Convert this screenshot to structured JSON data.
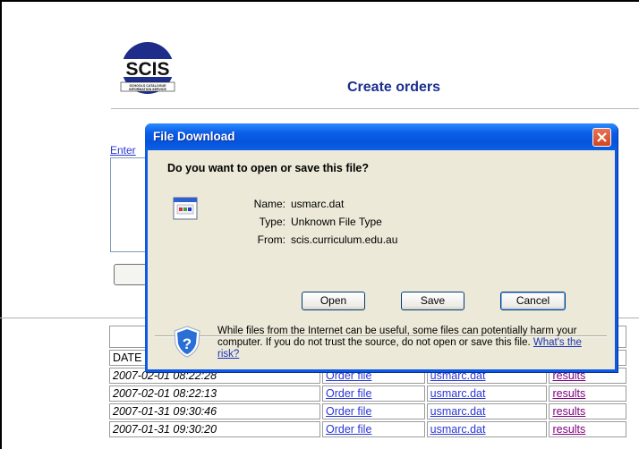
{
  "page": {
    "title": "Create orders",
    "logo_text": "SCIS",
    "logo_subtitle_1": "SCHOOLS CATALOGUE",
    "logo_subtitle_2": "INFORMATION SERVICE",
    "enter_link": "Enter"
  },
  "dialog": {
    "title": "File Download",
    "question": "Do you want to open or save this file?",
    "name_label": "Name:",
    "name_value": "usmarc.dat",
    "type_label": "Type:",
    "type_value": "Unknown File Type",
    "from_label": "From:",
    "from_value": "scis.curriculum.edu.au",
    "open_label": "Open",
    "save_label": "Save",
    "cancel_label": "Cancel",
    "warning_text": "While files from the Internet can be useful, some files can potentially harm your computer. If you do not trust the source, do not open or save this file.",
    "risk_link": "What's the risk?"
  },
  "table": {
    "date_header": "DATE",
    "rows": [
      {
        "date": "2007-02-01 08:22:28",
        "order": "Order file",
        "file": "usmarc.dat",
        "results": "results"
      },
      {
        "date": "2007-02-01 08:22:13",
        "order": "Order file",
        "file": "usmarc.dat",
        "results": "results"
      },
      {
        "date": "2007-01-31 09:30:46",
        "order": "Order file",
        "file": "usmarc.dat",
        "results": "results"
      },
      {
        "date": "2007-01-31 09:30:20",
        "order": "Order file",
        "file": "usmarc.dat",
        "results": "results"
      }
    ]
  },
  "colors": {
    "title_blue": "#1a2f8f",
    "link_blue": "#2b36d4",
    "visited_purple": "#800080",
    "dialog_blue": "#0b59e5",
    "dialog_face": "#ece9d8"
  }
}
